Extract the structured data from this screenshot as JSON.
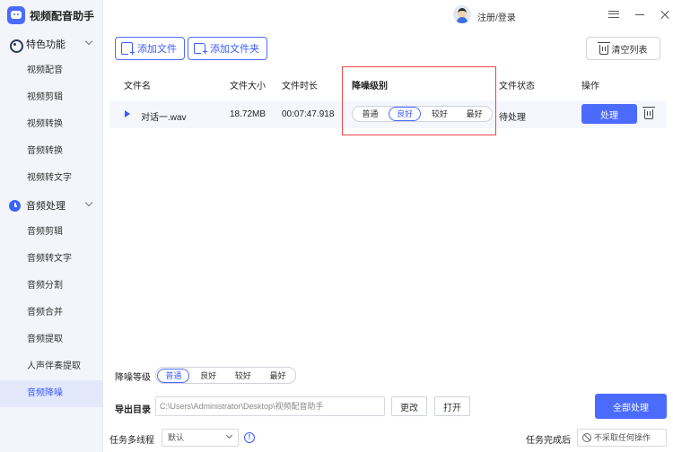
{
  "app": {
    "title": "视频配音助手"
  },
  "sidebar": {
    "groups": [
      {
        "label": "特色功能",
        "items": [
          "视频配音",
          "视频剪辑",
          "视频转换",
          "音频转换",
          "视频转文字"
        ]
      },
      {
        "label": "音频处理",
        "items": [
          "音频剪辑",
          "音频转文字",
          "音频分割",
          "音频合并",
          "音频提取",
          "人声伴奏提取",
          "音频降噪"
        ]
      }
    ],
    "active_item": "音频降噪"
  },
  "header": {
    "login_label": "注册/登录"
  },
  "toolbar": {
    "add_file_label": "添加文件",
    "add_folder_label": "添加文件夹",
    "clear_list_label": "清空列表"
  },
  "table": {
    "columns": [
      "文件名",
      "文件大小",
      "文件时长",
      "降噪级别",
      "文件状态",
      "操作"
    ],
    "rows": [
      {
        "name": "对话一.wav",
        "size": "18.72MB",
        "duration": "00:07:47.918",
        "levels": [
          "普通",
          "良好",
          "较好",
          "最好"
        ],
        "selected_level": "良好",
        "status": "待处理",
        "action_label": "处理"
      }
    ]
  },
  "bottom": {
    "noise_label": "降噪等级",
    "levels": [
      "普通",
      "良好",
      "较好",
      "最好"
    ],
    "selected_level": "普通",
    "output_label": "导出目录",
    "output_path": "C:\\Users\\Administrator\\Desktop\\视频配音助手",
    "change_label": "更改",
    "open_label": "打开",
    "process_all_label": "全部处理",
    "multithread_label": "任务多线程",
    "multithread_value": "默认",
    "after_done_label": "任务完成后",
    "after_done_value": "不采取任何操作"
  },
  "colors": {
    "accent": "#4b6bff",
    "highlight": "#e8494a",
    "sidebar_bg": "#f3f5fa",
    "active_bg": "#e3e8fb"
  }
}
